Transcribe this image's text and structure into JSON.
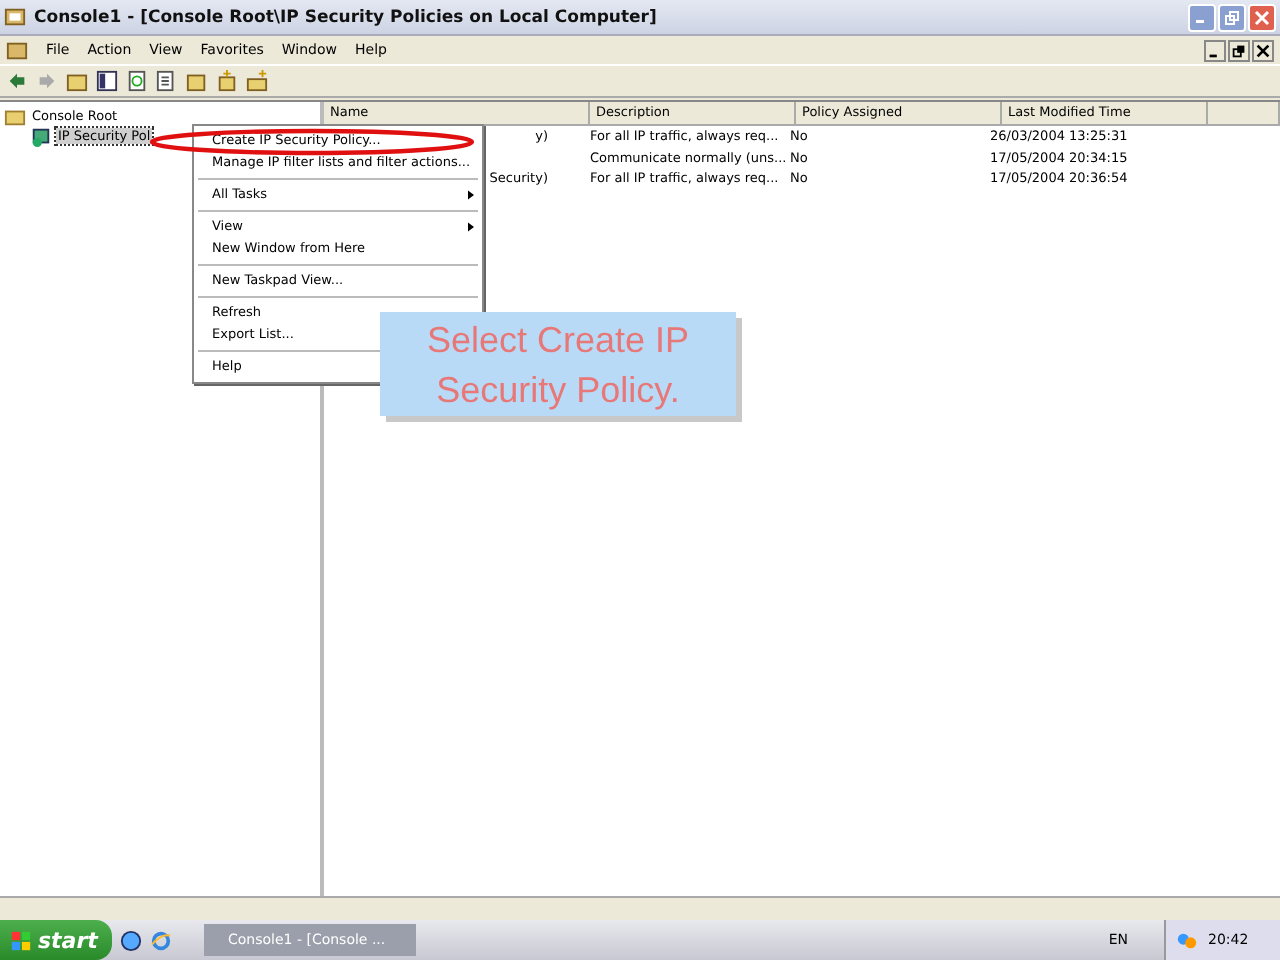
{
  "window": {
    "title": "Console1 - [Console Root\\IP Security Policies on Local Computer]"
  },
  "menu_bar": [
    "File",
    "Action",
    "View",
    "Favorites",
    "Window",
    "Help"
  ],
  "tree": [
    {
      "label": "Console Root",
      "children": [
        {
          "label": "IP Security Pol",
          "selected": true
        }
      ]
    }
  ],
  "table": {
    "columns": [
      "Name",
      "Description",
      "Policy Assigned",
      "Last Modified Time"
    ],
    "rows": [
      {
        "name": "y)",
        "description": "For all IP traffic, always req...",
        "assigned": "No",
        "modified": "26/03/2004 13:25:31"
      },
      {
        "name": "",
        "description": "Communicate normally (uns...",
        "assigned": "No",
        "modified": "17/05/2004 20:34:15"
      },
      {
        "name": "Security)",
        "description": "For all IP traffic, always req...",
        "assigned": "No",
        "modified": "17/05/2004 20:36:54"
      }
    ]
  },
  "context_menu": [
    {
      "kind": "item",
      "label": "Create IP Security Policy...",
      "submenu": false,
      "highlighted": true
    },
    {
      "kind": "item",
      "label": "Manage IP filter lists and filter actions...",
      "submenu": false,
      "highlighted": false
    },
    {
      "kind": "separator"
    },
    {
      "kind": "item",
      "label": "All Tasks",
      "submenu": true,
      "highlighted": false
    },
    {
      "kind": "separator"
    },
    {
      "kind": "item",
      "label": "View",
      "submenu": true,
      "highlighted": false
    },
    {
      "kind": "item",
      "label": "New Window from Here",
      "submenu": false,
      "highlighted": false
    },
    {
      "kind": "separator"
    },
    {
      "kind": "item",
      "label": "New Taskpad View...",
      "submenu": false,
      "highlighted": false
    },
    {
      "kind": "separator"
    },
    {
      "kind": "item",
      "label": "Refresh",
      "submenu": false,
      "highlighted": false
    },
    {
      "kind": "item",
      "label": "Export List...",
      "submenu": false,
      "highlighted": false
    },
    {
      "kind": "separator"
    },
    {
      "kind": "item",
      "label": "Help",
      "submenu": false,
      "highlighted": false
    }
  ],
  "callout": "Select Create IP Security Policy.",
  "taskbar": {
    "start": "start",
    "task": "Console1 - [Console ...",
    "language": "EN",
    "clock": "20:42"
  }
}
